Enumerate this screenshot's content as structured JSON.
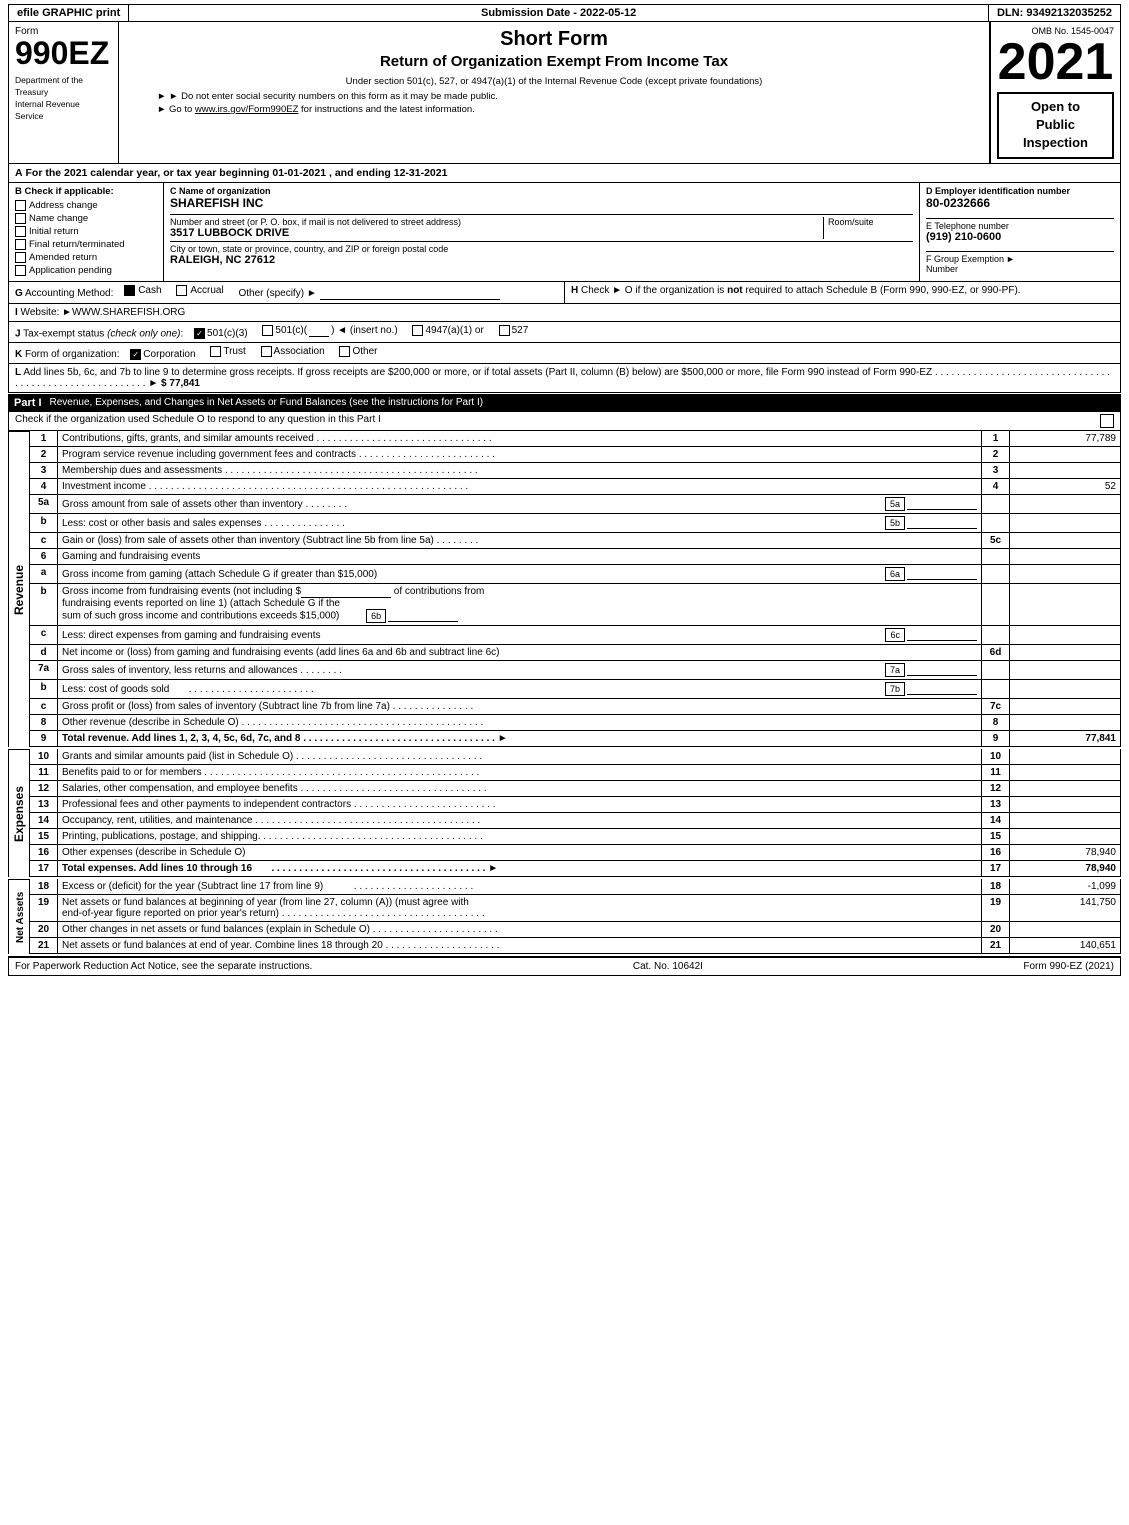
{
  "header": {
    "graphic_print": "efile GRAPHIC print",
    "submission_date_label": "Submission Date - 2022-05-12",
    "dln": "DLN: 93492132035252",
    "omb": "OMB No. 1545-0047"
  },
  "form": {
    "number": "990EZ",
    "form_label": "Form",
    "short_form": "Short Form",
    "return_title": "Return of Organization Exempt From Income Tax",
    "year": "2021",
    "subtitle": "Under section 501(c), 527, or 4947(a)(1) of the Internal Revenue Code (except private foundations)",
    "instruction1": "► Do not enter social security numbers on this form as it may be made public.",
    "instruction2": "► Go to www.irs.gov/Form990EZ for instructions and the latest information.",
    "open_to_public": "Open to\nPublic\nInspection"
  },
  "section_a": {
    "label": "A",
    "text": "For the 2021 calendar year, or tax year beginning 01-01-2021 , and ending 12-31-2021"
  },
  "section_b": {
    "label": "B  Check if applicable:",
    "checkboxes": [
      {
        "id": "address_change",
        "label": "Address change",
        "checked": false
      },
      {
        "id": "name_change",
        "label": "Name change",
        "checked": false
      },
      {
        "id": "initial_return",
        "label": "Initial return",
        "checked": false
      },
      {
        "id": "final_return",
        "label": "Final return/terminated",
        "checked": false
      },
      {
        "id": "amended_return",
        "label": "Amended return",
        "checked": false
      },
      {
        "id": "application_pending",
        "label": "Application pending",
        "checked": false
      }
    ]
  },
  "org": {
    "name_label": "C Name of organization",
    "name": "SHAREFISH INC",
    "address_label": "Number and street (or P. O. box, if mail is not delivered to street address)",
    "address": "3517 LUBBOCK DRIVE",
    "room_suite_label": "Room/suite",
    "room_suite": "",
    "city_label": "City or town, state or province, country, and ZIP or foreign postal code",
    "city": "RALEIGH, NC  27612",
    "ein_label": "D Employer identification number",
    "ein": "80-0232666",
    "phone_label": "E Telephone number",
    "phone": "(919) 210-0600",
    "group_exemption_label": "F Group Exemption\nNumber",
    "group_exemption": "►"
  },
  "section_g": {
    "label": "G",
    "text": "Accounting Method:",
    "cash_label": "Cash",
    "cash_checked": true,
    "accrual_label": "Accrual",
    "accrual_checked": false,
    "other_label": "Other (specify) ►",
    "line": "_______________________________"
  },
  "section_h": {
    "label": "H",
    "text": "Check ►  O if the organization is not required to attach Schedule B (Form 990, 990-EZ, or 990-PF)."
  },
  "section_i": {
    "label": "I",
    "text": "Website: ►WWW.SHAREFISH.ORG"
  },
  "section_j": {
    "label": "J",
    "text": "Tax-exempt status (check only one):",
    "options": [
      "501(c)(3)",
      "501(c)(",
      " )◄ (insert no.)",
      "4947(a)(1) or",
      "527"
    ],
    "checked": "501(c)(3)"
  },
  "section_k": {
    "label": "K",
    "text": "Form of organization:",
    "options": [
      "Corporation",
      "Trust",
      "Association",
      "Other"
    ],
    "checked": "Corporation"
  },
  "section_l": {
    "label": "L",
    "text": "Add lines 5b, 6c, and 7b to line 9 to determine gross receipts. If gross receipts are $200,000 or more, or if total assets (Part II, column (B) below) are $500,000 or more, file Form 990 instead of Form 990-EZ",
    "dots": ". . . . . . . . . . . . . . . . . . . . . . . . . . . . . . . . . . . . . . . . . . . . . . . . . . . . . . . .",
    "arrow": "►",
    "value": "$ 77,841"
  },
  "part1": {
    "label": "Part I",
    "title": "Revenue, Expenses, and Changes in Net Assets or Fund Balances",
    "see_instructions": "(see the instructions for Part I)",
    "check_text": "Check if the organization used Schedule O to respond to any question in this Part I",
    "lines": [
      {
        "num": "1",
        "desc": "Contributions, gifts, grants, and similar amounts received",
        "dots": true,
        "value": "77,789"
      },
      {
        "num": "2",
        "desc": "Program service revenue including government fees and contracts",
        "dots": true,
        "value": ""
      },
      {
        "num": "3",
        "desc": "Membership dues and assessments",
        "dots": true,
        "value": ""
      },
      {
        "num": "4",
        "desc": "Investment income",
        "dots": true,
        "value": "52"
      },
      {
        "num": "5a",
        "desc": "Gross amount from sale of assets other than inventory",
        "sub": "5a",
        "dots": true,
        "value": ""
      },
      {
        "num": "5b",
        "desc": "Less: cost or other basis and sales expenses",
        "sub": "5b",
        "dots": true,
        "value": ""
      },
      {
        "num": "5c",
        "desc": "Gain or (loss) from sale of assets other than inventory (Subtract line 5b from line 5a)",
        "dots": true,
        "value": ""
      },
      {
        "num": "6",
        "desc": "Gaming and fundraising events",
        "value": ""
      },
      {
        "num": "6a",
        "desc": "Gross income from gaming (attach Schedule G if greater than $15,000)",
        "sub": "6a",
        "value": ""
      },
      {
        "num": "6b",
        "desc_multi": true,
        "value": ""
      },
      {
        "num": "6c",
        "desc": "Less: direct expenses from gaming and fundraising events",
        "dots_small": true,
        "sub": "6c",
        "value": ""
      },
      {
        "num": "6d",
        "desc": "Net income or (loss) from gaming and fundraising events (add lines 6a and 6b and subtract line 6c)",
        "value": ""
      },
      {
        "num": "7a",
        "desc": "Gross sales of inventory, less returns and allowances",
        "sub": "7a",
        "dots": true,
        "value": ""
      },
      {
        "num": "7b",
        "desc": "Less: cost of goods sold",
        "sub": "7b",
        "dots": true,
        "value": ""
      },
      {
        "num": "7c",
        "desc": "Gross profit or (loss) from sales of inventory (Subtract line 7b from line 7a)",
        "dots": true,
        "value": ""
      },
      {
        "num": "8",
        "desc": "Other revenue (describe in Schedule O)",
        "dots": true,
        "value": ""
      },
      {
        "num": "9",
        "desc": "Total revenue. Add lines 1, 2, 3, 4, 5c, 6d, 7c, and 8",
        "dots": true,
        "arrow": true,
        "bold": true,
        "value": "77,841"
      }
    ]
  },
  "expenses": {
    "lines": [
      {
        "num": "10",
        "desc": "Grants and similar amounts paid (list in Schedule O)",
        "dots": true,
        "value": ""
      },
      {
        "num": "11",
        "desc": "Benefits paid to or for members",
        "dots": true,
        "value": ""
      },
      {
        "num": "12",
        "desc": "Salaries, other compensation, and employee benefits",
        "dots": true,
        "value": ""
      },
      {
        "num": "13",
        "desc": "Professional fees and other payments to independent contractors",
        "dots": true,
        "value": ""
      },
      {
        "num": "14",
        "desc": "Occupancy, rent, utilities, and maintenance",
        "dots": true,
        "value": ""
      },
      {
        "num": "15",
        "desc": "Printing, publications, postage, and shipping.",
        "dots": true,
        "value": ""
      },
      {
        "num": "16",
        "desc": "Other expenses (describe in Schedule O)",
        "value": "78,940"
      },
      {
        "num": "17",
        "desc": "Total expenses. Add lines 10 through 16",
        "dots": true,
        "arrow": true,
        "bold": true,
        "value": "78,940"
      }
    ]
  },
  "net_assets": {
    "lines": [
      {
        "num": "18",
        "desc": "Excess or (deficit) for the year (Subtract line 17 from line 9)",
        "dots": true,
        "value": "-1,099"
      },
      {
        "num": "19",
        "desc": "Net assets or fund balances at beginning of year (from line 27, column (A)) (must agree with end-of-year figure reported on prior year's return)",
        "dots": true,
        "value": "141,750"
      },
      {
        "num": "20",
        "desc": "Other changes in net assets or fund balances (explain in Schedule O)",
        "dots": true,
        "value": ""
      },
      {
        "num": "21",
        "desc": "Net assets or fund balances at end of year. Combine lines 18 through 20",
        "dots": true,
        "value": "140,651"
      }
    ]
  },
  "footer": {
    "paperwork_text": "For Paperwork Reduction Act Notice, see the separate instructions.",
    "cat_no": "Cat. No. 10642I",
    "form_ref": "Form 990-EZ (2021)"
  }
}
